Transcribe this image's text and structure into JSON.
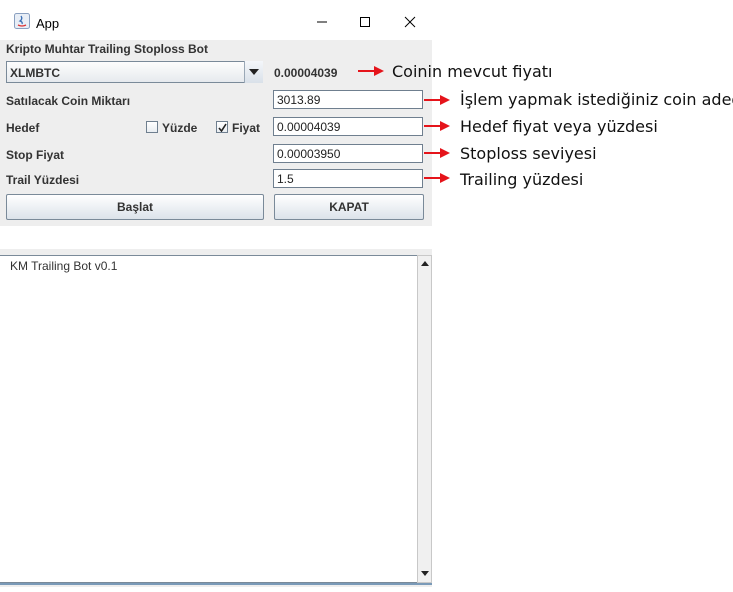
{
  "window": {
    "title": "App"
  },
  "panel": {
    "heading": "Kripto Muhtar Trailing Stoploss Bot",
    "coin_select": {
      "selected": "XLMBTC"
    },
    "current_price": "0.00004039",
    "fields": {
      "amount": {
        "label": "Satılacak Coin Miktarı",
        "value": "3013.89"
      },
      "target": {
        "label": "Hedef",
        "value": "0.00004039"
      },
      "stop": {
        "label": "Stop Fiyat",
        "value": "0.00003950"
      },
      "trail": {
        "label": "Trail Yüzdesi",
        "value": "1.5"
      }
    },
    "checkboxes": {
      "percent": {
        "label": "Yüzde",
        "checked": false
      },
      "price": {
        "label": "Fiyat",
        "checked": true
      }
    },
    "buttons": {
      "start": "Başlat",
      "close": "KAPAT"
    }
  },
  "log": {
    "text": "KM Trailing Bot v0.1"
  },
  "annotations": {
    "price": "Coinin mevcut fiyatı",
    "amount": "İşlem yapmak istediğiniz coin adedi",
    "target": "Hedef fiyat veya yüzdesi",
    "stop": "Stoploss seviyesi",
    "trail": "Trailing yüzdesi",
    "arrow_color": "#e5141b"
  }
}
